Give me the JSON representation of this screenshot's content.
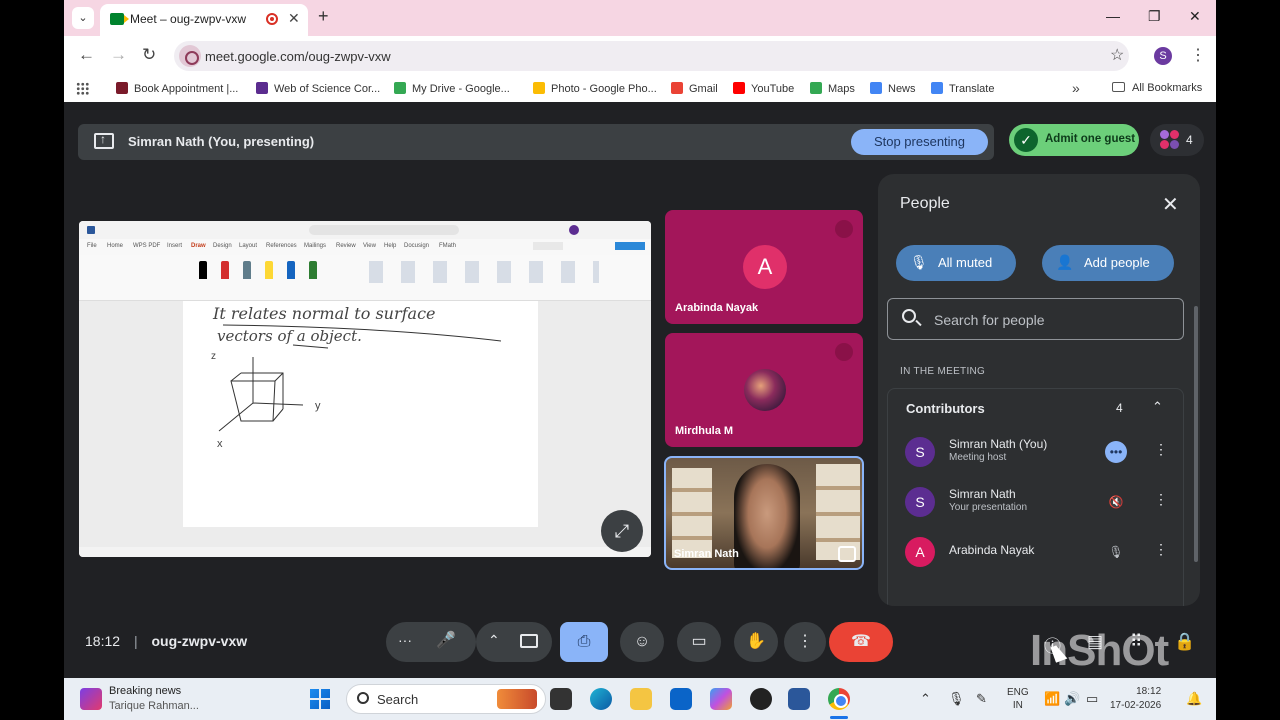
{
  "browser": {
    "tab_title": "Meet – oug-zwpv-vxw",
    "url": "meet.google.com/oug-zwpv-vxw",
    "profile_initial": "S",
    "bookmarks": [
      {
        "label": "Book Appointment |...",
        "icon_color": "#7a1a2a"
      },
      {
        "label": "Web of Science Cor...",
        "icon_color": "#5b2c8f"
      },
      {
        "label": "My Drive - Google...",
        "icon_color": "#34a853"
      },
      {
        "label": "Photo - Google Pho...",
        "icon_color": "#fbbc04"
      },
      {
        "label": "Gmail",
        "icon_color": "#ea4335"
      },
      {
        "label": "YouTube",
        "icon_color": "#ff0000"
      },
      {
        "label": "Maps",
        "icon_color": "#34a853"
      },
      {
        "label": "News",
        "icon_color": "#4285f4"
      },
      {
        "label": "Translate",
        "icon_color": "#4285f4"
      }
    ],
    "all_bookmarks": "All Bookmarks"
  },
  "meet": {
    "presenting_label": "Simran Nath (You, presenting)",
    "stop_presenting": "Stop presenting",
    "admit_label": "Admit one guest",
    "participant_count": "4",
    "meeting_time": "18:12",
    "meeting_code": "oug-zwpv-vxw"
  },
  "shared_screen": {
    "ribbon_tabs": [
      "File",
      "Home",
      "WPS PDF",
      "Insert",
      "Draw",
      "Design",
      "Layout",
      "References",
      "Mailings",
      "Review",
      "View",
      "Help",
      "Docusign",
      "FMath"
    ],
    "pen_colors": [
      "#000000",
      "#d32f2f",
      "#607d8b",
      "#fdd835",
      "#1565c0",
      "#2e7d32"
    ],
    "handwriting_line1": "It relates normal to surface",
    "handwriting_line2": "vectors of a object."
  },
  "tiles": [
    {
      "name": "Arabinda Nayak",
      "initial": "A"
    },
    {
      "name": "Mirdhula M"
    },
    {
      "name": "Simran Nath"
    }
  ],
  "people_panel": {
    "title": "People",
    "all_muted": "All muted",
    "add_people": "Add people",
    "search_placeholder": "Search for people",
    "section": "IN THE MEETING",
    "group_title": "Contributors",
    "group_count": "4",
    "people": [
      {
        "initial": "S",
        "name": "Simran Nath (You)",
        "sub": "Meeting host",
        "color": "#5c2d91"
      },
      {
        "initial": "S",
        "name": "Simran Nath",
        "sub": "Your presentation",
        "color": "#5c2d91"
      },
      {
        "initial": "A",
        "name": "Arabinda Nayak",
        "sub": "",
        "color": "#d81b60"
      }
    ]
  },
  "taskbar": {
    "news_title": "Breaking news",
    "news_sub": "Tarique Rahman...",
    "search": "Search",
    "lang_line1": "ENG",
    "lang_line2": "IN",
    "time": "18:12",
    "date": "17-02-2026"
  },
  "watermark": "InShOt"
}
